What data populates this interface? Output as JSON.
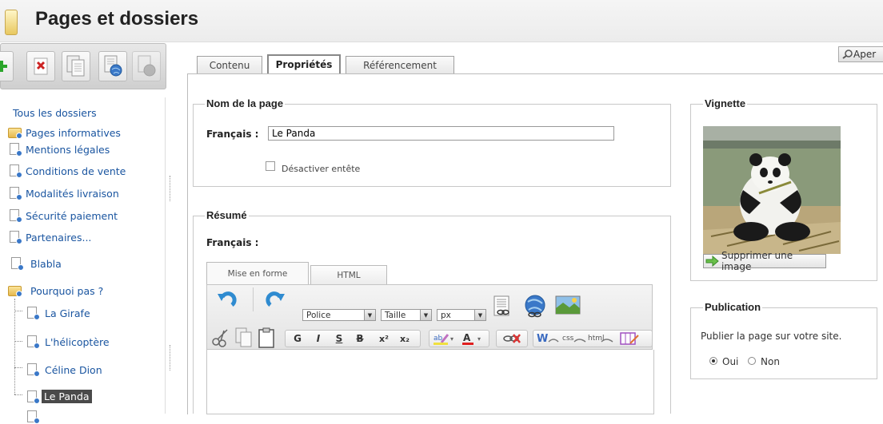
{
  "header": {
    "title": "Pages et dossiers"
  },
  "toolbar": {
    "buttons": [
      {
        "icon": "add-icon",
        "color": "#2aa52a"
      },
      {
        "icon": "delete-icon",
        "color": "#cc2222"
      },
      {
        "icon": "copy-page-icon"
      },
      {
        "icon": "publish-page-icon"
      },
      {
        "icon": "unpublish-page-icon"
      }
    ]
  },
  "tree": {
    "root": "Tous les dossiers",
    "items": [
      {
        "label": "Pages informatives",
        "type": "folder"
      },
      {
        "label": "Mentions légales",
        "type": "page"
      },
      {
        "label": "Conditions de vente",
        "type": "page"
      },
      {
        "label": "Modalités livraison",
        "type": "page"
      },
      {
        "label": "Sécurité paiement",
        "type": "page"
      },
      {
        "label": "Partenaires...",
        "type": "page"
      },
      {
        "label": "Blabla",
        "type": "page"
      },
      {
        "label": "Pourquoi pas ?",
        "type": "folder"
      },
      {
        "label": "La Girafe",
        "type": "page"
      },
      {
        "label": "L'hélicoptère",
        "type": "page"
      },
      {
        "label": "Céline Dion",
        "type": "page"
      },
      {
        "label": "Le Panda",
        "type": "page",
        "selected": true
      }
    ]
  },
  "tabs": [
    {
      "label": "Contenu",
      "active": false
    },
    {
      "label": "Propriétés",
      "active": true
    },
    {
      "label": "Référencement",
      "active": false
    }
  ],
  "apercu_label": "Aper",
  "page_name": {
    "legend": "Nom de la page",
    "lang_label": "Français :",
    "value": "Le Panda",
    "checkbox_label": "Désactiver entête",
    "checkbox_checked": false
  },
  "resume": {
    "legend": "Résumé",
    "lang_label": "Français :",
    "editor_tabs": [
      "Mise en forme",
      "HTML"
    ],
    "font_select": "Police",
    "size_select": "Taille",
    "unit_select": "px",
    "format_buttons": [
      "G",
      "I",
      "S",
      "B",
      "x²",
      "x₂"
    ],
    "content": ""
  },
  "vignette": {
    "legend": "Vignette",
    "delete_label": "Supprimer une image"
  },
  "publication": {
    "legend": "Publication",
    "text": "Publier la page sur votre site.",
    "options": [
      {
        "label": "Oui",
        "selected": true
      },
      {
        "label": "Non",
        "selected": false
      }
    ]
  }
}
